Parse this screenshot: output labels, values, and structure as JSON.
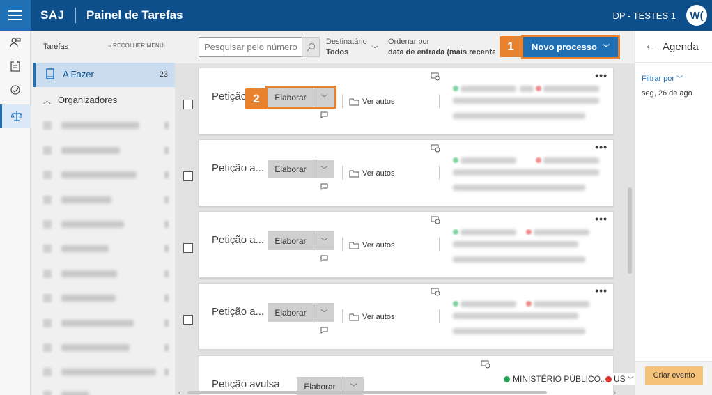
{
  "header": {
    "app_name": "SAJ",
    "page_title": "Painel de Tarefas",
    "user_name": "DP - TESTES 1",
    "avatar_initials": "W("
  },
  "sidebar": {
    "heading": "Tarefas",
    "collapse_label": "« RECOLHER MENU",
    "active_item": {
      "label": "A Fazer",
      "count": "23"
    },
    "organizers_label": "Organizadores"
  },
  "toolbar": {
    "search_placeholder": "Pesquisar pelo número",
    "recipient_label": "Destinatário",
    "recipient_value": "Todos",
    "order_label": "Ordenar por",
    "order_value": "data de entrada (mais recente)",
    "new_process_label": "Novo processo"
  },
  "callouts": {
    "one": "1",
    "two": "2"
  },
  "cards": [
    {
      "title": "Petição",
      "action": "Elaborar",
      "link": "Ver autos"
    },
    {
      "title": "Petição a...",
      "action": "Elaborar",
      "link": "Ver autos"
    },
    {
      "title": "Petição a...",
      "action": "Elaborar",
      "link": "Ver autos"
    },
    {
      "title": "Petição a...",
      "action": "Elaborar",
      "link": "Ver autos"
    },
    {
      "title": "Petição avulsa",
      "action": "Elaborar",
      "link": ""
    }
  ],
  "badges": {
    "mp": "MINISTÉRIO PÚBLICO...",
    "us": "US"
  },
  "agenda": {
    "title": "Agenda",
    "filter_label": "Filtrar por",
    "date": "seg, 26 de ago",
    "create_event": "Criar evento"
  },
  "colors": {
    "header": "#0d4f8b",
    "accent": "#1f6fb5",
    "callout": "#e8822e"
  }
}
